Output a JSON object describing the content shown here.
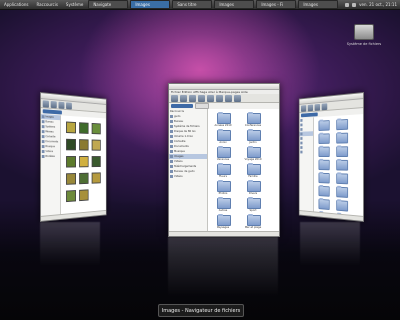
{
  "topbar": {
    "menus": [
      "Applications",
      "Raccourcis",
      "Système"
    ],
    "tasks": [
      {
        "label": "Navigate",
        "active": false
      },
      {
        "label": "Images",
        "active": true
      },
      {
        "label": "Sans titre",
        "active": false
      },
      {
        "label": "Images",
        "active": false
      },
      {
        "label": "Images - Fi",
        "active": false
      },
      {
        "label": "Images",
        "active": false
      }
    ],
    "clock": "ven. 21 oct., 21:11"
  },
  "desktop_icon": {
    "label": "Système de fichiers",
    "icon": "drive-icon"
  },
  "caption": "Images - Navigateur de fichiers",
  "windows": {
    "left": {
      "sidebar": [
        "Images",
        "Bureau",
        "Système",
        "Réseau",
        "Corbeille",
        "Documents",
        "Musique",
        "Vidéos",
        "Modèles"
      ]
    },
    "center": {
      "menubar": "Fichier Édition Affichage Aller à Marque-pages Aide",
      "location": "Images",
      "sidebar": [
        "Raccourcis",
        "gudo",
        "Bureau",
        "Système de fichiers",
        "Disque de 80 Go",
        "Volume 1.0 Go",
        "Corbeille",
        "Documents",
        "Musique",
        "Images",
        "Vidéos",
        "Téléchargements",
        "Bureau de gudo",
        "Vidéos"
      ],
      "folders": [
        "Années 2010",
        "Conférences",
        "Anniv",
        "Jardin",
        "Vacances",
        "Voyage 2010",
        "Fleurs",
        "Famille",
        "Photos",
        "Divers",
        "Autres",
        "Sport",
        "Paysages",
        "Mer et plage",
        "Fond d'écran",
        "Mes Photos",
        "Noël",
        "Projets"
      ]
    },
    "right": {
      "folders": [
        "Images",
        "Autres",
        "Fleurs",
        "Noël",
        "Divers",
        "Sport",
        "Photos",
        "Mer",
        "Famille",
        "Jardin",
        "Vacances",
        "Voyage",
        "Fond",
        "Projets",
        "Anniv",
        "Paysages"
      ]
    }
  }
}
